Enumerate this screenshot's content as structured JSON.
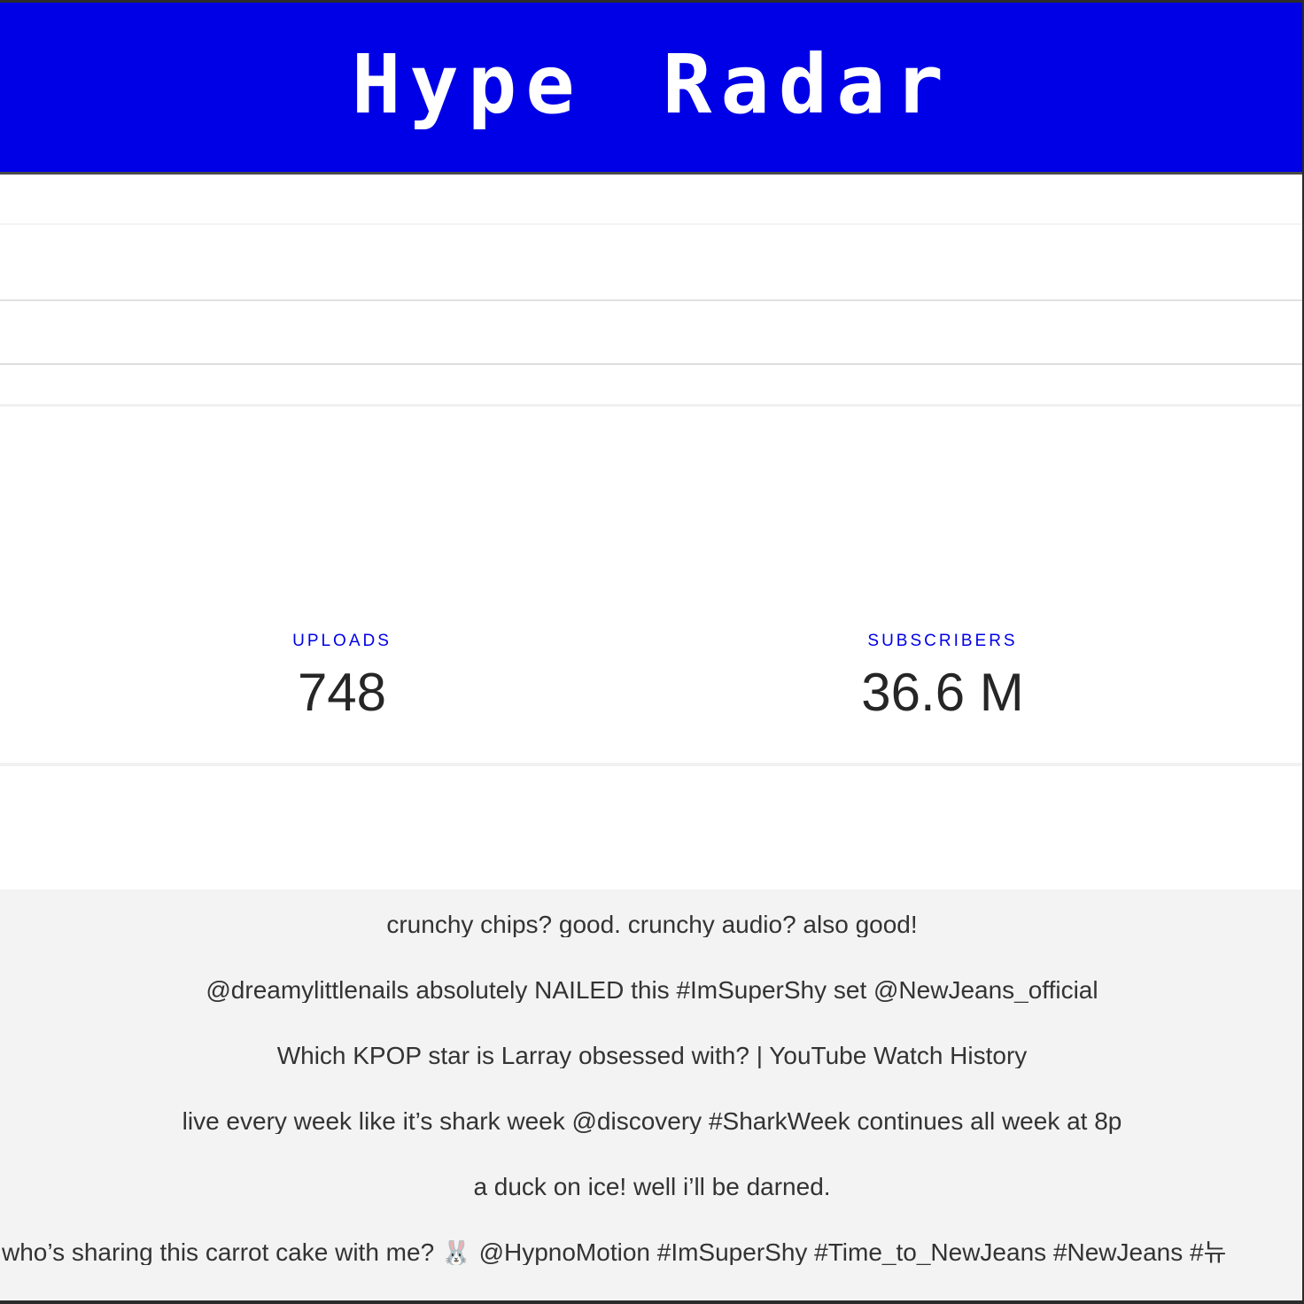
{
  "app": {
    "title": "Hype Radar"
  },
  "stats": {
    "uploads": {
      "label": "UPLOADS",
      "value": "748"
    },
    "subscribers": {
      "label": "SUBSCRIBERS",
      "value": "36.6 M"
    }
  },
  "feed": {
    "items": [
      "crunchy chips? good. crunchy audio? also good!",
      "@dreamylittlenails absolutely NAILED this #ImSuperShy set @NewJeans_official",
      "Which KPOP star is Larray obsessed with? | YouTube Watch History",
      "live every week like it’s shark week @discovery #SharkWeek continues all week at 8p",
      "a duck on ice! well i’ll be darned.",
      "who’s sharing this carrot cake with me? 🐰 @HypnoMotion #ImSuperShy #Time_to_NewJeans #NewJeans #뉴"
    ]
  },
  "colors": {
    "header_bg": "#0000e6",
    "accent": "#0000e6",
    "value_text": "#262626",
    "feed_bg": "#f3f3f3"
  }
}
